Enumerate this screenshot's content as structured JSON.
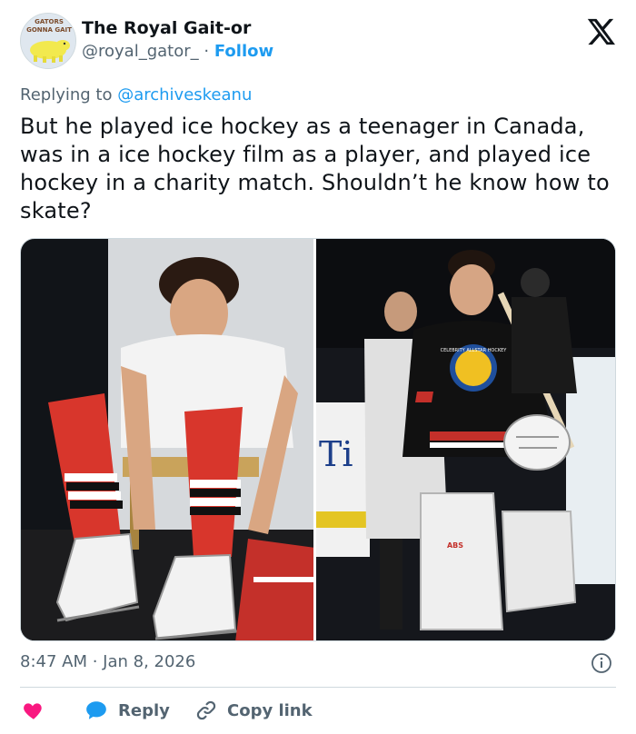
{
  "account": {
    "avatar_text": "GATORS GONNA GAIT",
    "display_name": "The Royal Gait-or",
    "handle": "@royal_gator_",
    "separator": "·",
    "follow_label": "Follow"
  },
  "reply_context": {
    "prefix": "Replying to ",
    "target": "@archiveskeanu"
  },
  "tweet": {
    "text": "But he played ice hockey as a teenager in Canada, was in a ice hockey film as a player, and played ice hockey in a charity match. Shouldn’t he know how to skate?"
  },
  "media": {
    "jersey_text": "CELEBRITY ALLSTAR HOCKEY",
    "rink_sign_text": "Ti",
    "pad_text": "ABS"
  },
  "meta": {
    "timestamp": "8:47 AM · Jan 8, 2026"
  },
  "actions": {
    "reply_label": "Reply",
    "copy_label": "Copy link"
  },
  "colors": {
    "accent": "#1d9bf0",
    "like": "#f91880",
    "muted": "#536471"
  },
  "icons": [
    "x-logo-icon",
    "info-icon",
    "heart-icon",
    "reply-bubble-icon",
    "link-icon"
  ]
}
